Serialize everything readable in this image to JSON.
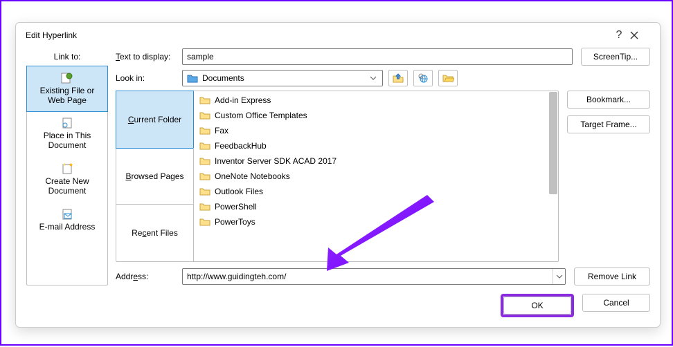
{
  "dialog": {
    "title": "Edit Hyperlink",
    "help": "?"
  },
  "linkto": {
    "label": "Link to:",
    "items": [
      {
        "label_line1": "Existing File or",
        "label_line2": "Web Page"
      },
      {
        "label_line1": "Place in This",
        "label_line2": "Document"
      },
      {
        "label_line1": "Create New",
        "label_line2": "Document"
      },
      {
        "label_line1": "E-mail Address",
        "label_line2": ""
      }
    ]
  },
  "text_to_display": {
    "label": "Text to display:",
    "value": "sample"
  },
  "look_in": {
    "label": "Look in:",
    "value": "Documents"
  },
  "tabs": {
    "current": "Current Folder",
    "browsed": "Browsed Pages",
    "recent": "Recent Files"
  },
  "files": [
    "Add-in Express",
    "Custom Office Templates",
    "Fax",
    "FeedbackHub",
    "Inventor Server SDK ACAD 2017",
    "OneNote Notebooks",
    "Outlook Files",
    "PowerShell",
    "PowerToys"
  ],
  "address": {
    "label": "Address:",
    "value": "http://www.guidingteh.com/"
  },
  "buttons": {
    "screentip": "ScreenTip...",
    "bookmark": "Bookmark...",
    "target_frame": "Target Frame...",
    "remove_link": "Remove Link",
    "ok": "OK",
    "cancel": "Cancel"
  }
}
